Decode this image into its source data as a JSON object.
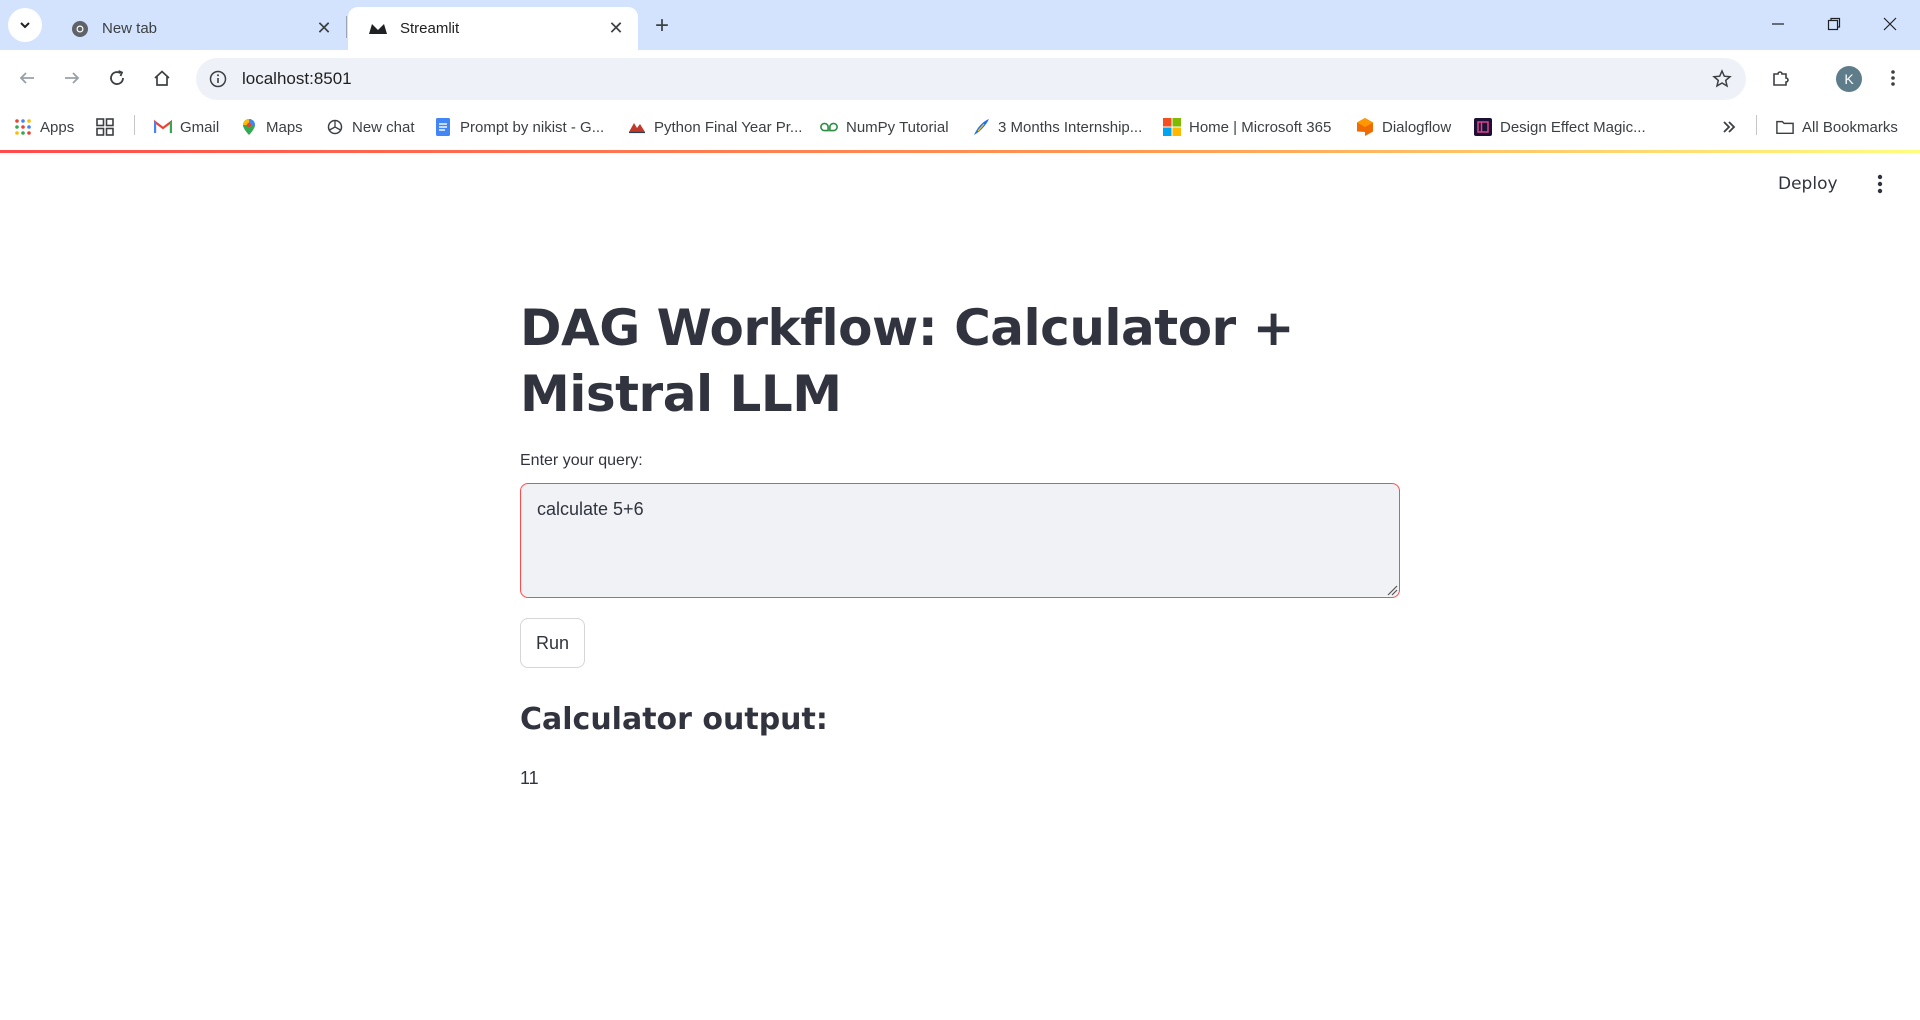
{
  "browser": {
    "tabs": [
      {
        "title": "New tab",
        "active": false
      },
      {
        "title": "Streamlit",
        "active": true
      }
    ],
    "address": "localhost:8501",
    "profile_initial": "K",
    "bookmarks": [
      {
        "label": "Apps"
      },
      {
        "label": "Gmail"
      },
      {
        "label": "Maps"
      },
      {
        "label": "New chat"
      },
      {
        "label": "Prompt by nikist - G..."
      },
      {
        "label": "Python Final Year Pr..."
      },
      {
        "label": "NumPy Tutorial"
      },
      {
        "label": "3 Months Internship..."
      },
      {
        "label": "Home | Microsoft 365"
      },
      {
        "label": "Dialogflow"
      },
      {
        "label": "Design Effect Magic..."
      }
    ],
    "all_bookmarks": "All Bookmarks"
  },
  "app": {
    "deploy_label": "Deploy",
    "title": "DAG Workflow: Calculator + Mistral LLM",
    "query_label": "Enter your query:",
    "query_value": "calculate 5+6",
    "run_label": "Run",
    "output_heading": "Calculator output:",
    "output_value": "11"
  },
  "colors": {
    "accent": "#ff4b4b",
    "text": "#31333f",
    "tabstrip": "#d3e3fd",
    "input_bg": "#f0f2f6"
  }
}
